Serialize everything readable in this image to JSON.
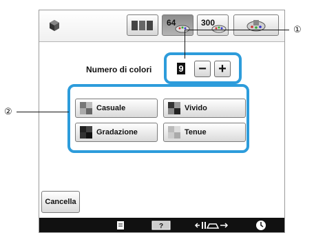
{
  "top_bar": {
    "palette_tab_64_label": "64",
    "palette_tab_300_label": "300"
  },
  "color_count": {
    "label": "Numero di colori",
    "value": "9",
    "minus_label": "−",
    "plus_label": "+"
  },
  "modes": [
    {
      "label": "Casuale"
    },
    {
      "label": "Vivido"
    },
    {
      "label": "Gradazione"
    },
    {
      "label": "Tenue"
    }
  ],
  "cancel_label": "Cancella",
  "callouts": {
    "one": "①",
    "two": "②"
  },
  "colors": {
    "highlight": "#2d9cdb",
    "bottom_bar": "#111111"
  },
  "icons": [
    "gear-icon",
    "spools-icon",
    "palette-icon",
    "page-icon",
    "help-icon",
    "presser-foot-icon",
    "clock-icon"
  ]
}
